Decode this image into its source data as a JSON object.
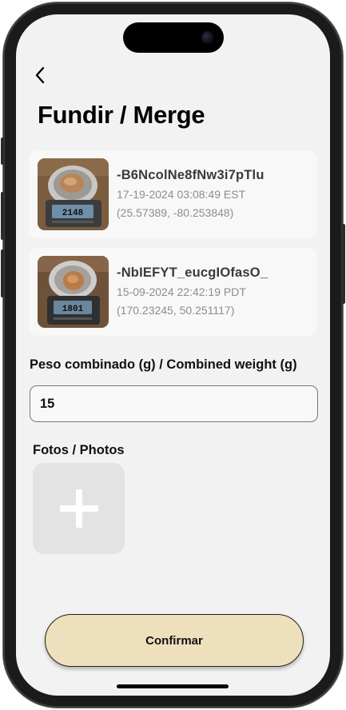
{
  "header": {
    "back_icon": "chevron-left-icon",
    "title": "Fundir / Merge"
  },
  "items": [
    {
      "id": "-B6NcolNe8fNw3i7pTlu",
      "date": "17-19-2024 03:08:49 EST",
      "coords": "(25.57389, -80.253848)",
      "scale_reading": "2148"
    },
    {
      "id": "-NbIEFYT_eucgIOfasO_",
      "date": "15-09-2024 22:42:19 PDT",
      "coords": "(170.23245, 50.251117)",
      "scale_reading": "1801"
    }
  ],
  "weight": {
    "label": "Peso combinado (g) / Combined weight (g)",
    "value": "15"
  },
  "photos": {
    "label": "Fotos / Photos",
    "add_icon": "plus-icon"
  },
  "actions": {
    "confirm_label": "Confirmar"
  },
  "colors": {
    "screen_background": "#f2f2f2",
    "card_background": "#f8f8f8",
    "confirm_button": "#efe0bd",
    "add_photo_tile": "#e3e3e3",
    "secondary_text": "#8d8d8d"
  }
}
